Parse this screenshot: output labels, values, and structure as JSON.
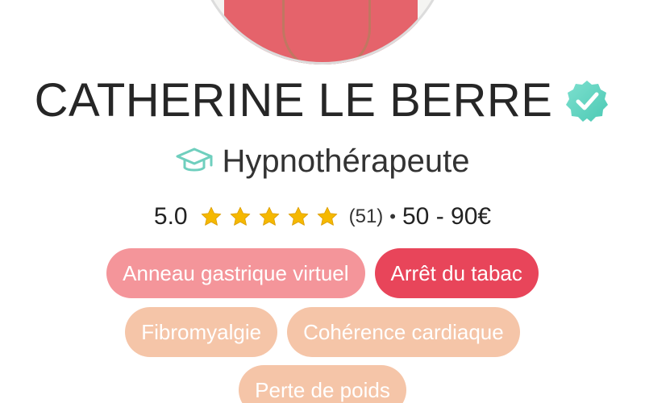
{
  "profile": {
    "name": "CATHERINE LE BERRE",
    "role": "Hypnothérapeute",
    "rating": "5.0",
    "stars": 5,
    "review_count": "(51)",
    "separator": "•",
    "price_range": "50 - 90€"
  },
  "tags": {
    "row1": [
      "Anneau gastrique virtuel",
      "Arrêt du tabac"
    ],
    "row2": [
      "Fibromyalgie",
      "Cohérence cardiaque"
    ],
    "row3": [
      "Perte de poids"
    ]
  },
  "colors": {
    "verified_badge": "#5ed6c0",
    "role_icon": "#6fcfbe",
    "star": "#f5b800",
    "tag_light_pink": "#f4959a",
    "tag_strong_pink": "#e8455a",
    "tag_peach": "#f5c5a8"
  },
  "icons": {
    "verified": "verified-badge-icon",
    "role": "graduation-cap-icon",
    "star": "star-icon"
  }
}
